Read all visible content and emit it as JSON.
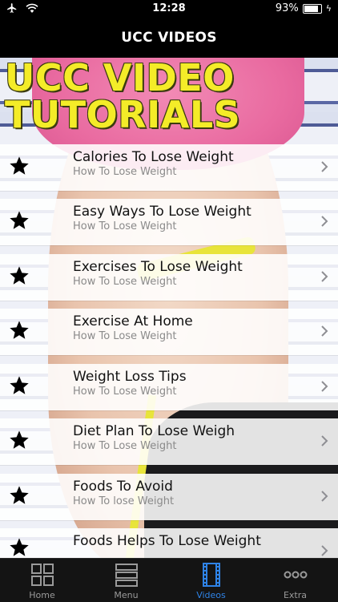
{
  "status": {
    "time": "12:28",
    "battery": "93%",
    "battery_level": 0.93
  },
  "navbar": {
    "title": "UCC VIDEOS"
  },
  "hero": {
    "title_line1": "UCC VIDEO",
    "title_line2": "TUTORIALS"
  },
  "list": {
    "items": [
      {
        "title": "Calories To Lose Weight",
        "subtitle": "How To Lose Weight",
        "icon": "star-icon"
      },
      {
        "title": "Easy Ways To Lose Weight",
        "subtitle": "How To Lose Weight",
        "icon": "star-icon"
      },
      {
        "title": "Exercises To Lose Weight",
        "subtitle": "How To Lose Weight",
        "icon": "star-icon"
      },
      {
        "title": "Exercise At Home",
        "subtitle": "How To Lose Weight",
        "icon": "star-icon"
      },
      {
        "title": "Weight Loss Tips",
        "subtitle": "How To Lose Weight",
        "icon": "star-icon"
      },
      {
        "title": "Diet Plan To Lose Weigh",
        "subtitle": "How To Lose Weight",
        "icon": "star-icon"
      },
      {
        "title": "Foods To Avoid",
        "subtitle": "How To lose Weight",
        "icon": "star-icon"
      },
      {
        "title": "Foods Helps To Lose Weight",
        "subtitle": "",
        "icon": "star-icon"
      }
    ]
  },
  "tabbar": {
    "tabs": [
      {
        "label": "Home",
        "icon": "grid-icon"
      },
      {
        "label": "Menu",
        "icon": "list-icon"
      },
      {
        "label": "Videos",
        "icon": "film-icon"
      },
      {
        "label": "Extra",
        "icon": "more-icon"
      }
    ],
    "active_color": "#2f83e6",
    "inactive_color": "#9a9a9a"
  }
}
